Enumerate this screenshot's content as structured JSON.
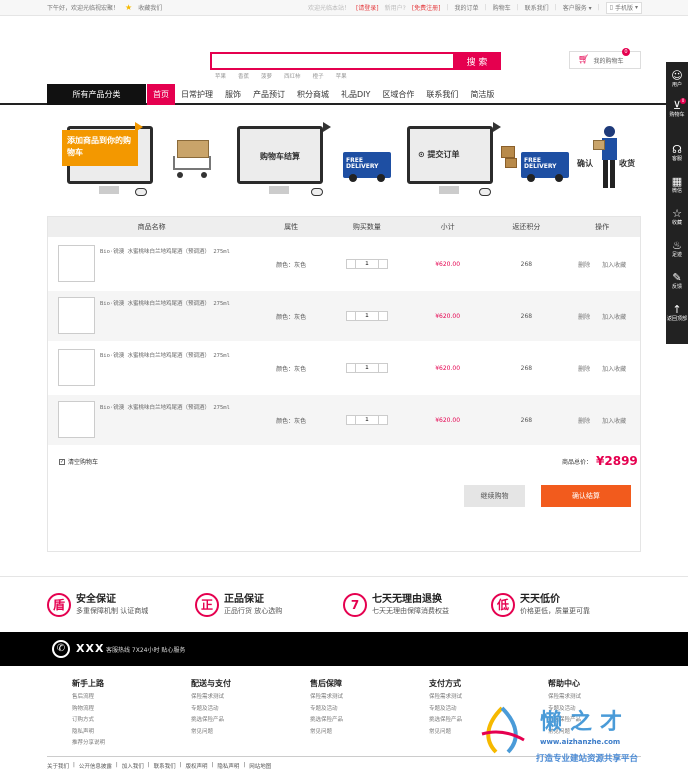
{
  "topbar": {
    "greeting": "下午好，欢迎光临视宏聚！",
    "favorite": "收藏我们",
    "login_prompt": "欢迎光临本站！",
    "login": "[请登录]",
    "new_user": "新用户?",
    "register": "[免费注册]",
    "my_orders": "我的订单",
    "cart": "购物车",
    "contact": "联系我们",
    "service": "客户服务",
    "mobile": "手机版"
  },
  "search": {
    "placeholder": "",
    "button": "搜 索",
    "hotwords": [
      "苹果",
      "香蕉",
      "菠萝",
      "西红柿",
      "橙子",
      "苹果"
    ]
  },
  "header_cart": {
    "label": "我的购物车",
    "count": "0"
  },
  "nav": {
    "category": "所有产品分类",
    "items": [
      "首页",
      "日常护理",
      "服饰",
      "产品预订",
      "积分商城",
      "礼品DIY",
      "区域合作",
      "联系我们",
      "简洁版"
    ]
  },
  "steps": {
    "step1": "添加商品到你的购物车",
    "step2": "购物车结算",
    "step3": "提交订单",
    "step4_a": "确认",
    "step4_b": "收货",
    "free_delivery": "FREE DELIVERY"
  },
  "table": {
    "headers": [
      "商品名称",
      "属性",
      "购买数量",
      "小计",
      "返还积分",
      "操作"
    ],
    "rows": [
      {
        "name": "Bio·锐澳 水蜜桃味白兰地鸡尾酒（预调酒） 275ml",
        "attr": "颜色：灰色",
        "qty": "1",
        "subtotal": "¥620.00",
        "points": "268",
        "delete": "删除",
        "fav": "加入收藏"
      },
      {
        "name": "Bio·锐澳 水蜜桃味白兰地鸡尾酒（预调酒） 275ml",
        "attr": "颜色：灰色",
        "qty": "1",
        "subtotal": "¥620.00",
        "points": "268",
        "delete": "删除",
        "fav": "加入收藏"
      },
      {
        "name": "Bio·锐澳 水蜜桃味白兰地鸡尾酒（预调酒） 275ml",
        "attr": "颜色：灰色",
        "qty": "1",
        "subtotal": "¥620.00",
        "points": "268",
        "delete": "删除",
        "fav": "加入收藏"
      },
      {
        "name": "Bio·锐澳 水蜜桃味白兰地鸡尾酒（预调酒） 275ml",
        "attr": "颜色：灰色",
        "qty": "1",
        "subtotal": "¥620.00",
        "points": "268",
        "delete": "删除",
        "fav": "加入收藏"
      }
    ],
    "clear": "清空购物车",
    "total_label": "商品总价：",
    "total_value": "¥2899",
    "continue": "继续购物",
    "checkout": "确认结算"
  },
  "guarantees": [
    {
      "icon": "盾",
      "title": "安全保证",
      "sub": "多重保障机制 认证商城"
    },
    {
      "icon": "正",
      "title": "正品保证",
      "sub": "正品行货 放心选购"
    },
    {
      "icon": "7",
      "title": "七天无理由退换",
      "sub": "七天无理由保障消费权益"
    },
    {
      "icon": "低",
      "title": "天天低价",
      "sub": "价格更低，质量更可靠"
    }
  ],
  "hotline": {
    "brand": "XXX",
    "text": "客服热线 7X24小时 贴心服务"
  },
  "footer_cols": [
    {
      "title": "新手上路",
      "items": [
        "售后流程",
        "购物流程",
        "订购方式",
        "隐私声明",
        "推荐分享说明"
      ]
    },
    {
      "title": "配送与支付",
      "items": [
        "保险需求测试",
        "专题及活动",
        "挑选保险产品",
        "常见问题"
      ]
    },
    {
      "title": "售后保障",
      "items": [
        "保险需求测试",
        "专题及活动",
        "挑选保险产品",
        "常见问题"
      ]
    },
    {
      "title": "支付方式",
      "items": [
        "保险需求测试",
        "专题及活动",
        "挑选保险产品",
        "常见问题"
      ]
    },
    {
      "title": "帮助中心",
      "items": [
        "保险需求测试",
        "专题及活动",
        "挑选保险产品",
        "常见问题"
      ]
    }
  ],
  "footer_links": [
    "关于我们",
    "|",
    "公开信息披露",
    "|",
    "加入我们",
    "|",
    "联系我们",
    "|",
    "版权声明",
    "|",
    "隐私声明",
    "|",
    "网站地图"
  ],
  "sidebar": {
    "user": "用户",
    "cart": "购物车",
    "cart_count": "0",
    "service": "客服",
    "wechat": "微信",
    "favorite": "收藏",
    "footprint": "足迹",
    "feedback": "反馈",
    "top": "返回顶部"
  },
  "watermark": {
    "brand": "懒之才",
    "url": "www.aizhanzhe.com",
    "slogan": "打造专业建站资源共享平台"
  },
  "colors": {
    "accent": "#e5004f",
    "orange": "#f25b1d",
    "dark": "#222222"
  }
}
